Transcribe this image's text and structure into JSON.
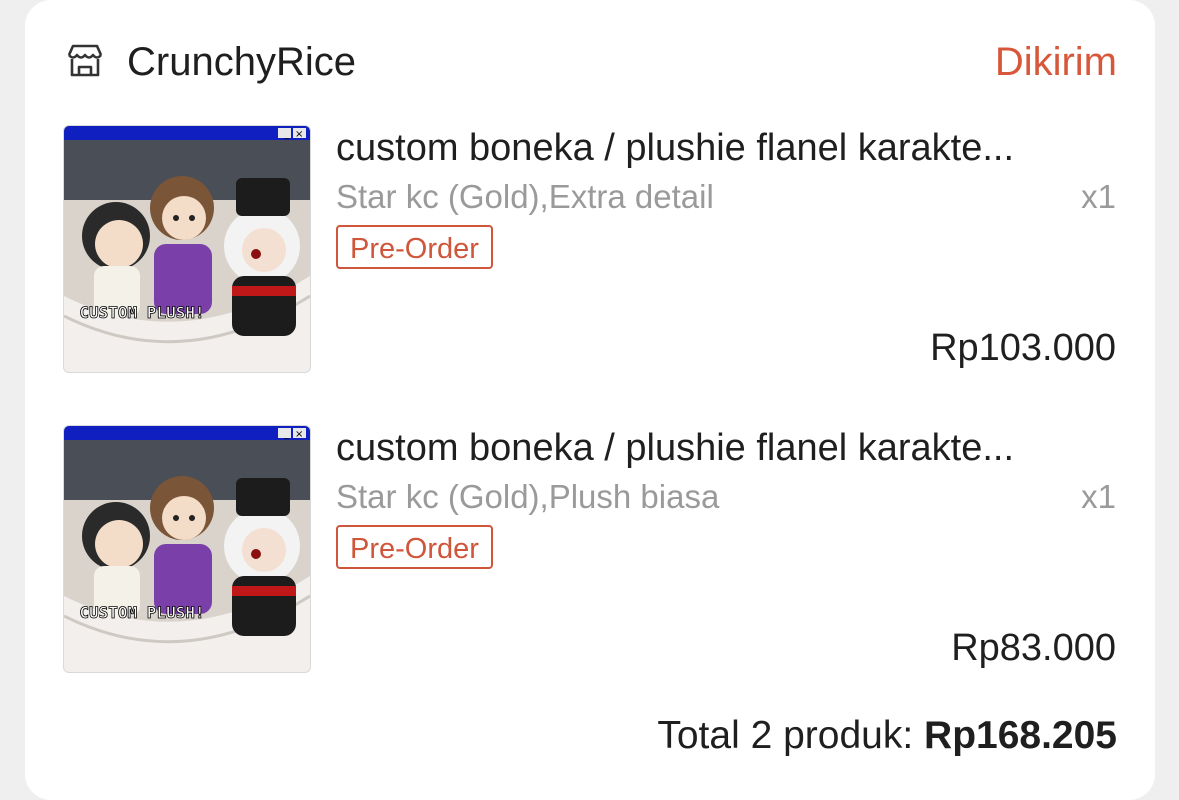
{
  "shop": {
    "name": "CrunchyRice",
    "status": "Dikirim",
    "icon": "store-icon"
  },
  "items": [
    {
      "title": "custom boneka / plushie flanel karakte...",
      "variant": "Star kc (Gold),Extra detail",
      "qty": "x1",
      "badge": "Pre-Order",
      "price": "Rp103.000",
      "image_caption": "CUSTOM PLUSH!"
    },
    {
      "title": "custom boneka / plushie flanel karakte...",
      "variant": "Star kc (Gold),Plush biasa",
      "qty": "x1",
      "badge": "Pre-Order",
      "price": "Rp83.000",
      "image_caption": "CUSTOM PLUSH!"
    }
  ],
  "summary": {
    "total_label": "Total 2 produk:",
    "total_value": "Rp168.205"
  },
  "colors": {
    "accent": "#d8573a",
    "muted": "#9a9a9a",
    "text": "#1f1f1f"
  }
}
